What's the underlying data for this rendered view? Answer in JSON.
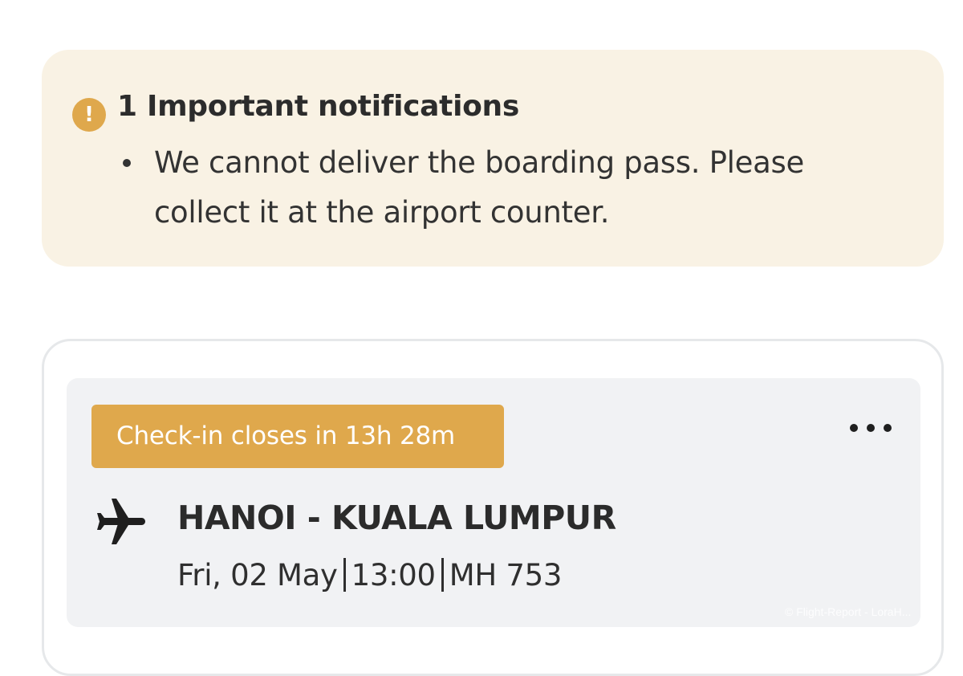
{
  "notifications": {
    "icon": "exclamation-circle-icon",
    "icon_glyph": "!",
    "accent_color": "#dfa84c",
    "background_color": "#f9f2e4",
    "title": "1 Important notifications",
    "items": [
      {
        "text": "We cannot deliver the boarding pass. Please collect it at the airport counter."
      }
    ]
  },
  "flight_card": {
    "checkin_badge": "Check-in closes in 13h 28m",
    "more_icon": "more-horizontal-icon",
    "plane_icon": "airplane-icon",
    "route": "HANOI - KUALA LUMPUR",
    "date": "Fri, 02 May",
    "time": "13:00",
    "flight_number": "MH 753"
  },
  "watermark": "© Flight-Report - LoraH..."
}
